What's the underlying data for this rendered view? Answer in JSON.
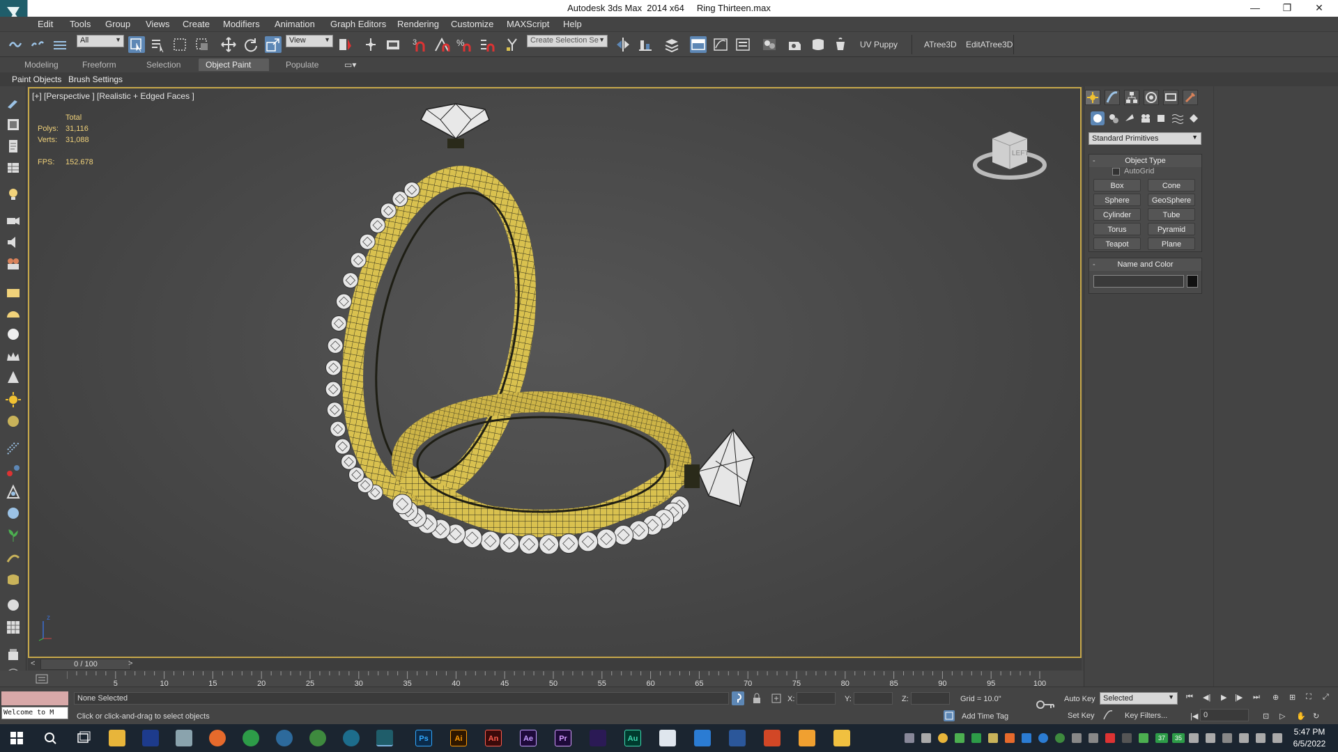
{
  "title_bar": {
    "title": "Autodesk 3ds Max  2014 x64     Ring Thirteen.max",
    "minimize": "—",
    "restore": "❐",
    "close": "✕"
  },
  "menu": [
    "Edit",
    "Tools",
    "Group",
    "Views",
    "Create",
    "Modifiers",
    "Animation",
    "Graph Editors",
    "Rendering",
    "Customize",
    "MAXScript",
    "Help"
  ],
  "main_toolbar": {
    "selection_filter": "All",
    "reference_coord": "View",
    "named_selection_placeholder": "Create Selection Se",
    "uv_puppy": "UV Puppy",
    "atree": "ATree3D",
    "edit_atree": "EditATree3D"
  },
  "ribbon": {
    "tabs": [
      "Modeling",
      "Freeform",
      "Selection",
      "Object Paint",
      "Populate"
    ],
    "active_tab": "Object Paint",
    "subtabs": [
      "Paint Objects",
      "Brush Settings"
    ]
  },
  "viewport": {
    "label": "[+] [Perspective ] [Realistic + Edged Faces ]",
    "stats": {
      "total_label": "Total",
      "polys_label": "Polys:",
      "polys": "31,116",
      "verts_label": "Verts:",
      "verts": "31,088",
      "fps_label": "FPS:",
      "fps": "152.678"
    },
    "viewcube_label": "LEFT",
    "axis_z": "z",
    "colors": {
      "gold": "#d9c14f",
      "wire": "#2a2a1a",
      "gem": "#e8e8e8",
      "border": "#c7a84a"
    }
  },
  "command_panel": {
    "category": "Standard Primitives",
    "object_type_title": "Object Type",
    "autogrid": "AutoGrid",
    "primitives": [
      "Box",
      "Cone",
      "Sphere",
      "GeoSphere",
      "Cylinder",
      "Tube",
      "Torus",
      "Pyramid",
      "Teapot",
      "Plane"
    ],
    "name_color_title": "Name and Color",
    "rollout_minus": "-"
  },
  "timeline": {
    "frame_display": "0 / 100",
    "prev": "<",
    "next": ">",
    "tick_labels": [
      "5",
      "10",
      "15",
      "20",
      "25",
      "30",
      "35",
      "40",
      "45",
      "50",
      "55",
      "60",
      "65",
      "70",
      "75",
      "80",
      "85",
      "90",
      "95",
      "100"
    ]
  },
  "status": {
    "welcome": "Welcome to M",
    "selection": "None Selected",
    "prompt": "Click or click-and-drag to select objects",
    "x_label": "X:",
    "y_label": "Y:",
    "z_label": "Z:",
    "grid": "Grid = 10.0\"",
    "add_time_tag": "Add Time Tag",
    "auto_key": "Auto Key",
    "set_key": "Set Key",
    "key_mode": "Selected",
    "key_filters": "Key Filters...",
    "current_frame": "0"
  },
  "taskbar": {
    "time": "5:47 PM",
    "date": "6/5/2022",
    "apps": [
      {
        "name": "Ps",
        "color": "#0b2b4a",
        "fg": "#31a8ff"
      },
      {
        "name": "Ai",
        "color": "#2e1700",
        "fg": "#ff9a00"
      },
      {
        "name": "An",
        "color": "#3b0a0a",
        "fg": "#ff5c4d"
      },
      {
        "name": "Ae",
        "color": "#1e0a3a",
        "fg": "#c49bff"
      },
      {
        "name": "Pr",
        "color": "#1e0a3a",
        "fg": "#d49bff"
      },
      {
        "name": "Au",
        "color": "#003b2e",
        "fg": "#3dd9b0"
      }
    ],
    "tray_37": "37",
    "tray_35": "35"
  }
}
